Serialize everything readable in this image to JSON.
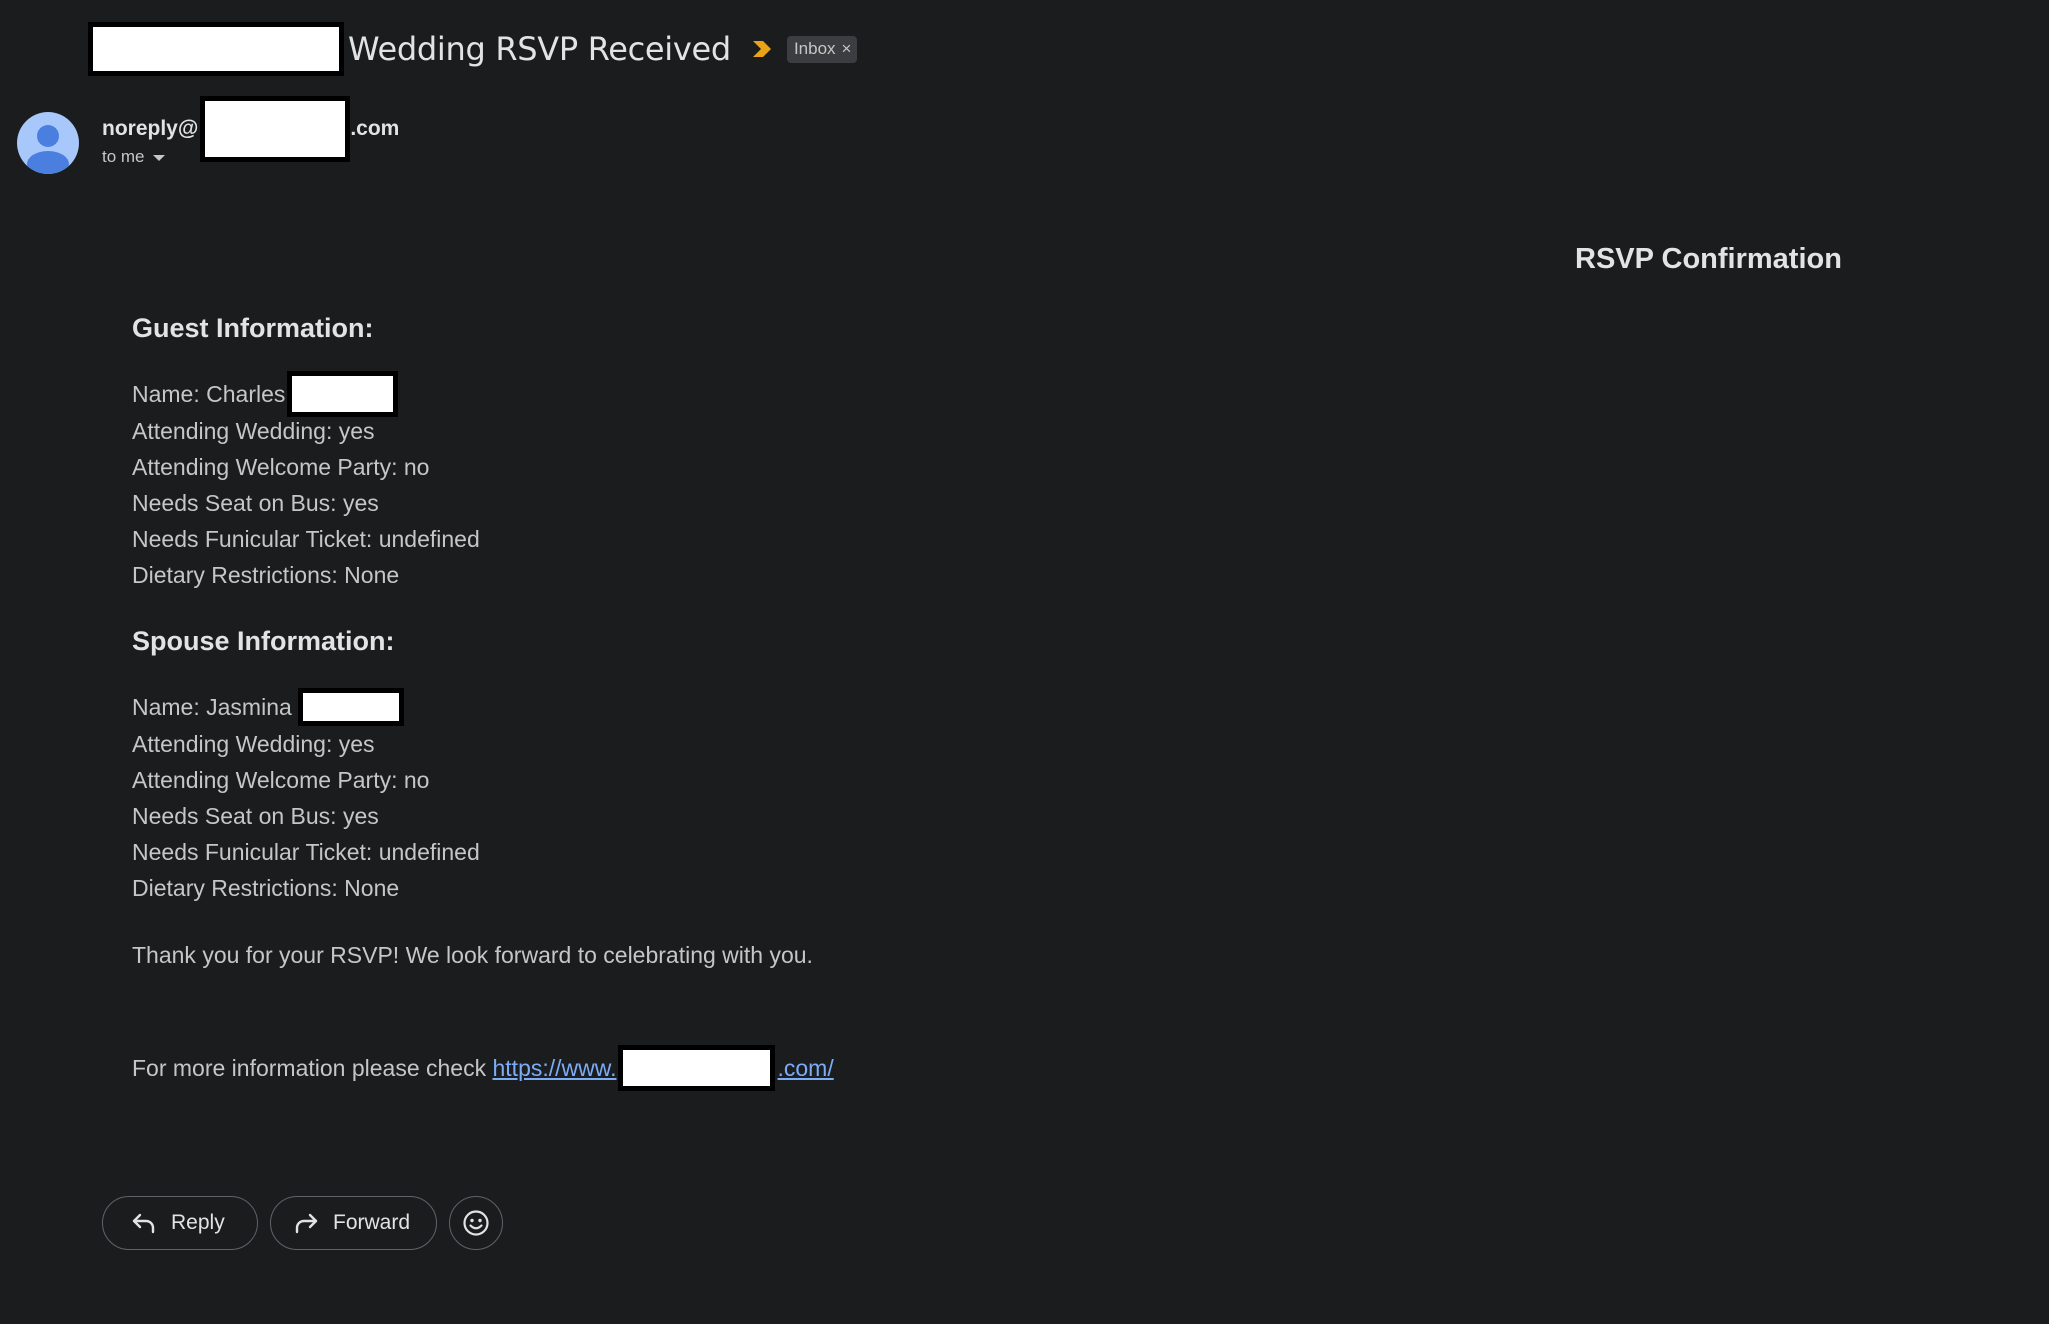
{
  "subject": {
    "text": "Wedding RSVP Received",
    "label_chip": "Inbox",
    "chip_close": "×",
    "importance_color": "#e8a317"
  },
  "sender": {
    "prefix": "noreply@",
    "suffix": ".com",
    "recipient_text": "to me"
  },
  "body": {
    "title": "RSVP Confirmation",
    "guest": {
      "heading": "Guest Information:",
      "name_prefix": "Name: Charles",
      "attending_wedding": "Attending Wedding: yes",
      "attending_welcome_party": "Attending Welcome Party: no",
      "needs_seat_on_bus": "Needs Seat on Bus: yes",
      "needs_funicular_ticket": "Needs Funicular Ticket: undefined",
      "dietary_restrictions": "Dietary Restrictions: None"
    },
    "spouse": {
      "heading": "Spouse Information:",
      "name_prefix": "Name: Jasmina",
      "attending_wedding": "Attending Wedding: yes",
      "attending_welcome_party": "Attending Welcome Party: no",
      "needs_seat_on_bus": "Needs Seat on Bus: yes",
      "needs_funicular_ticket": "Needs Funicular Ticket: undefined",
      "dietary_restrictions": "Dietary Restrictions: None"
    },
    "thank_you": "Thank you for your RSVP! We look forward to celebrating with you.",
    "more_info_prefix": "For more information please check ",
    "link_prefix": "https://www.",
    "link_suffix": ".com/"
  },
  "actions": {
    "reply_label": "Reply",
    "forward_label": "Forward",
    "emoji_icon": "smiley-icon"
  },
  "colors": {
    "background": "#1b1c1e",
    "link": "#7cacf8",
    "avatar": "#a8c7fa",
    "redaction": "#ffffff"
  }
}
